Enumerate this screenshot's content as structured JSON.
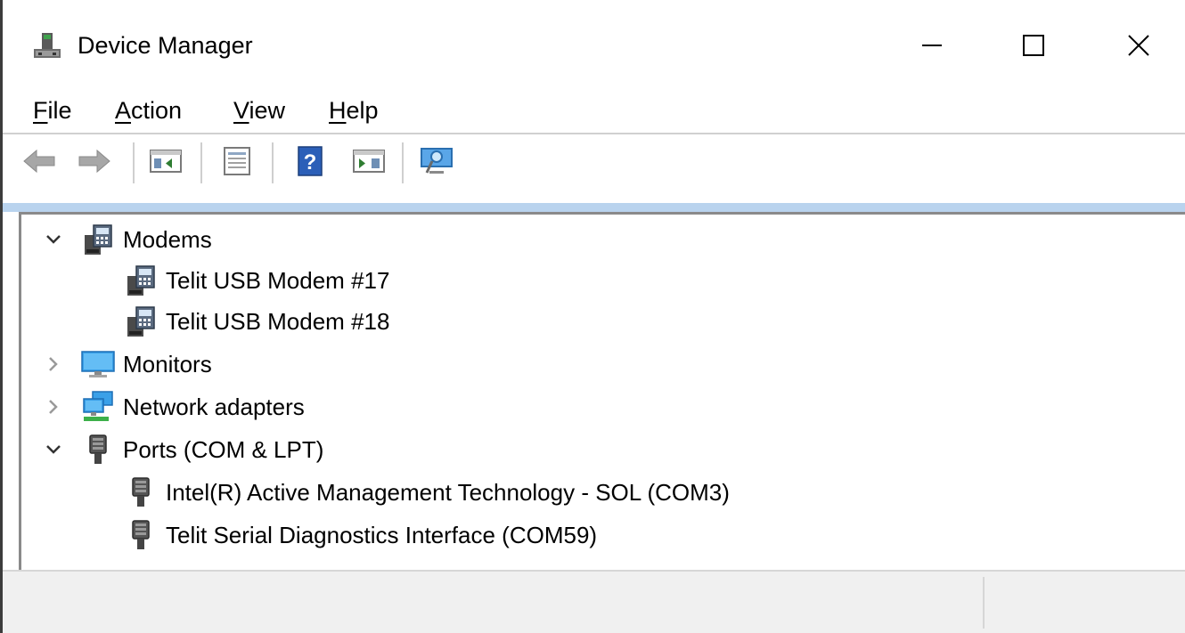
{
  "window": {
    "title": "Device Manager",
    "icon": "device-manager-icon",
    "controls": {
      "minimize": "minimize-icon",
      "maximize": "maximize-icon",
      "close": "close-icon"
    }
  },
  "menu": {
    "file": {
      "accel": "F",
      "rest": "ile"
    },
    "action": {
      "accel": "A",
      "rest": "ction"
    },
    "view": {
      "accel": "V",
      "rest": "iew"
    },
    "help": {
      "accel": "H",
      "rest": "elp"
    }
  },
  "toolbar": {
    "buttons": [
      "back-arrow-icon",
      "forward-arrow-icon",
      "show-hide-console-tree-icon",
      "properties-icon",
      "help-icon",
      "action-pane-icon",
      "scan-for-hardware-changes-icon"
    ]
  },
  "tree": {
    "categories": [
      {
        "label": "Modems",
        "expanded": true,
        "icon": "modem-icon",
        "children": [
          {
            "label": "Telit USB Modem #17",
            "icon": "modem-icon"
          },
          {
            "label": "Telit USB Modem #18",
            "icon": "modem-icon"
          }
        ]
      },
      {
        "label": "Monitors",
        "expanded": false,
        "icon": "monitor-icon"
      },
      {
        "label": "Network adapters",
        "expanded": false,
        "icon": "network-adapter-icon"
      },
      {
        "label": "Ports (COM & LPT)",
        "expanded": true,
        "icon": "port-icon",
        "children": [
          {
            "label": "Intel(R) Active Management Technology - SOL (COM3)",
            "icon": "port-icon"
          },
          {
            "label": "Telit Serial Diagnostics Interface (COM59)",
            "icon": "port-icon"
          }
        ]
      }
    ]
  },
  "colors": {
    "accent_strip": "#b9d3ee",
    "statusbar_bg": "#f0f0f0"
  }
}
